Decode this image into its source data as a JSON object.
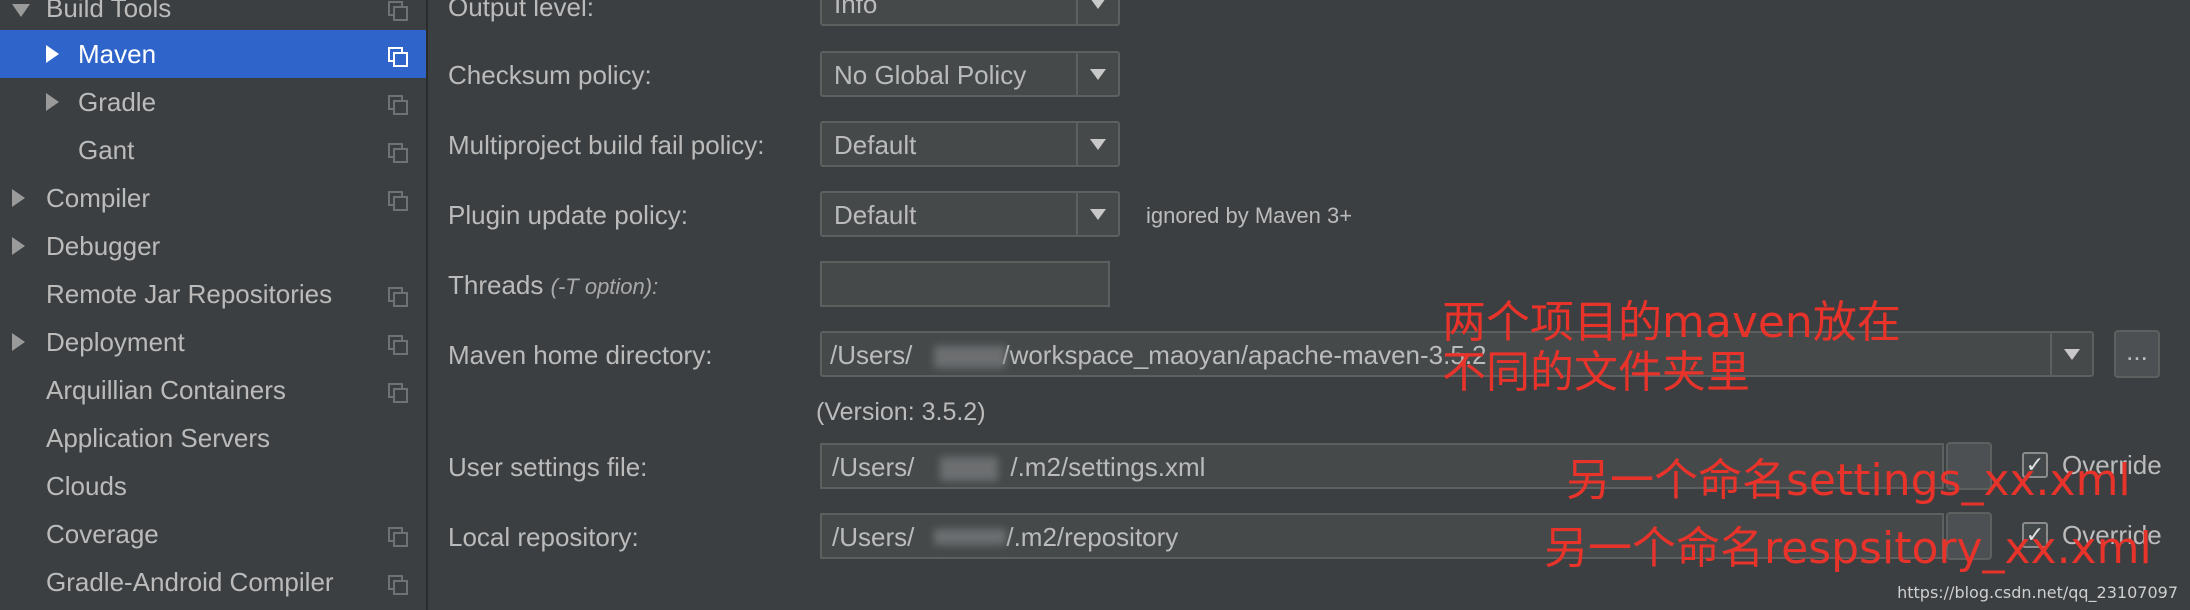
{
  "sidebar": {
    "items": [
      {
        "label": "Build Tools"
      },
      {
        "label": "Maven"
      },
      {
        "label": "Gradle"
      },
      {
        "label": "Gant"
      },
      {
        "label": "Compiler"
      },
      {
        "label": "Debugger"
      },
      {
        "label": "Remote Jar Repositories"
      },
      {
        "label": "Deployment"
      },
      {
        "label": "Arquillian Containers"
      },
      {
        "label": "Application Servers"
      },
      {
        "label": "Clouds"
      },
      {
        "label": "Coverage"
      },
      {
        "label": "Gradle-Android Compiler"
      }
    ],
    "selected": "Maven"
  },
  "form": {
    "output_level": {
      "label": "Output level:",
      "value": "Info"
    },
    "checksum_policy": {
      "label": "Checksum policy:",
      "value": "No Global Policy"
    },
    "multiproject_fail_policy": {
      "label": "Multiproject build fail policy:",
      "value": "Default"
    },
    "plugin_update_policy": {
      "label": "Plugin update policy:",
      "value": "Default",
      "note": "ignored by Maven 3+"
    },
    "threads": {
      "label": "Threads",
      "hint": "(-T option):",
      "value": ""
    },
    "maven_home": {
      "label": "Maven home directory:",
      "value_prefix": "/Users/",
      "value_suffix": "/workspace_maoyan/apache-maven-3.5.2",
      "browse": "...",
      "version": "(Version: 3.5.2)"
    },
    "user_settings": {
      "label": "User settings file:",
      "value_prefix": "/Users/",
      "value_suffix": "/.m2/settings.xml",
      "override": "Override"
    },
    "local_repository": {
      "label": "Local repository:",
      "value_prefix": "/Users/",
      "value_suffix": "/.m2/repository",
      "override": "Override"
    }
  },
  "annotations": {
    "line1": "两个项目的maven放在",
    "line2": "不同的文件夹里",
    "settings": "另一个命名settings_xx.xml",
    "repository": "另一个命名respsitory_xx.xml"
  },
  "watermark": "https://blog.csdn.net/qq_23107097",
  "colors": {
    "background": "#3c3f41",
    "selection": "#2f65ca",
    "annotation": "#e8332b"
  }
}
